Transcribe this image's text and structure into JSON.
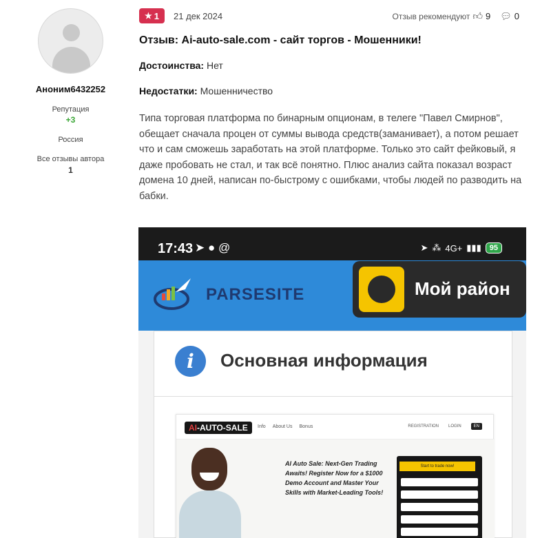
{
  "author": {
    "name": "Аноним6432252",
    "reputation_label": "Репутация",
    "reputation_value": "+3",
    "country": "Россия",
    "all_reviews_label": "Все отзывы автора",
    "all_reviews_count": "1"
  },
  "review": {
    "rating": "1",
    "date": "21 дек 2024",
    "recommend_label": "Отзыв рекомендуют",
    "likes": "9",
    "comments": "0",
    "title": "Отзыв: Ai-auto-sale.com - сайт торгов - Мошенники!",
    "pros_label": "Достоинства:",
    "pros_value": "Нет",
    "cons_label": "Недостатки:",
    "cons_value": "Мошенничество",
    "text": "Типа торговая платформа по бинарным опционам, в телеге \"Павел Смирнов\", обещает сначала процен от суммы вывода средств(заманивает), а потом решает что и сам сможешь заработать на этой платформе. Только это сайт фейковый, я даже пробовать не стал, и так всё понятно. Плюс анализ сайта показал возраст домена 10 дней, написан по-быстрому с ошибками, чтобы людей по разводить на бабки."
  },
  "screenshot": {
    "time": "17:43",
    "battery": "95",
    "net": "4G+",
    "parsesite": "PARSESITE",
    "rayon": "Мой район",
    "info_title": "Основная информация",
    "site": {
      "logo_ai": "AI",
      "logo_rest": "-AUTO-SALE",
      "links": [
        "Info",
        "About Us",
        "Bonus"
      ],
      "registration": "REGISTRATION",
      "login": "LOGIN",
      "lang": "EN",
      "hero": "AI Auto Sale: Next-Gen Trading Awaits! Register Now for a $1000 Demo Account and Master Your Skills with Market-Leading Tools!",
      "cta": "Start to trade now!"
    }
  },
  "colors": {
    "badge": "#d6304f",
    "reputation": "#3aa635",
    "banner": "#2e8ad9",
    "rayon_yellow": "#f5c400"
  }
}
